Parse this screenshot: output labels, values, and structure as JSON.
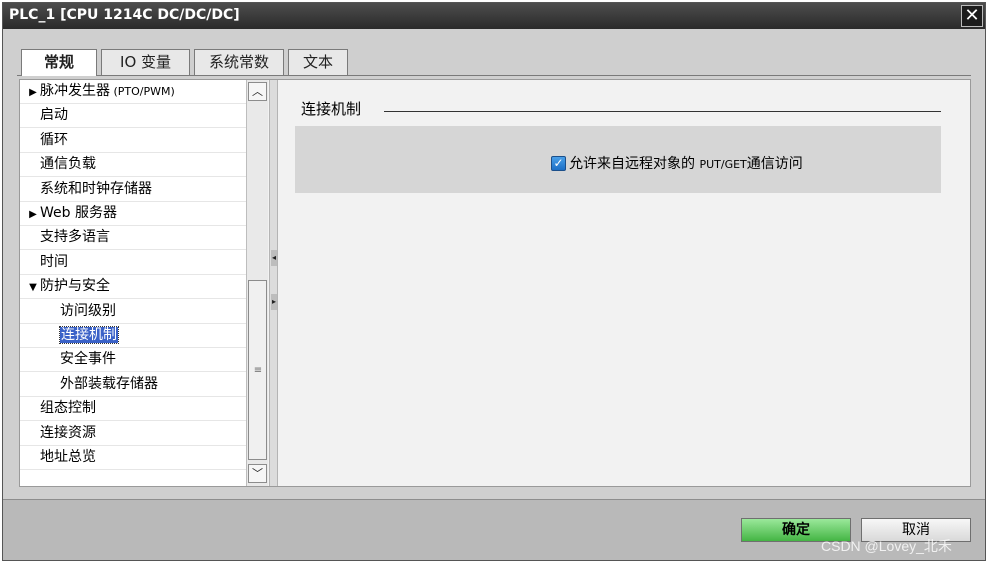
{
  "window": {
    "title": "PLC_1 [CPU 1214C DC/DC/DC]",
    "close_glyph": "✕"
  },
  "tabs": [
    {
      "label": "常规",
      "active": true
    },
    {
      "label": "IO 变量",
      "active": false
    },
    {
      "label": "系统常数",
      "active": false
    },
    {
      "label": "文本",
      "active": false
    }
  ],
  "nav": {
    "items": [
      {
        "label": "脉冲发生器",
        "suffix": " (PTO/PWM)",
        "expander": "▶",
        "indent": 0
      },
      {
        "label": "启动",
        "indent": 0
      },
      {
        "label": "循环",
        "indent": 0
      },
      {
        "label": "通信负载",
        "indent": 0
      },
      {
        "label": "系统和时钟存储器",
        "indent": 0
      },
      {
        "label": "Web 服务器",
        "expander": "▶",
        "indent": 0
      },
      {
        "label": "支持多语言",
        "indent": 0
      },
      {
        "label": "时间",
        "indent": 0
      },
      {
        "label": "防护与安全",
        "expander": "▼",
        "indent": 0
      },
      {
        "label": "访问级别",
        "indent": 1
      },
      {
        "label": "连接机制",
        "indent": 1,
        "selected": true
      },
      {
        "label": "安全事件",
        "indent": 1
      },
      {
        "label": "外部装载存储器",
        "indent": 1
      },
      {
        "label": "组态控制",
        "indent": 0
      },
      {
        "label": "连接资源",
        "indent": 0
      },
      {
        "label": "地址总览",
        "indent": 0
      }
    ],
    "scroll_up_glyph": "︿",
    "scroll_down_glyph": "﹀",
    "grip_glyph": "≡"
  },
  "section": {
    "title": "连接机制",
    "checkbox_checked": true,
    "checkbox_label_pre": "允许来自远程对象的 ",
    "checkbox_label_code": "PUT/GET",
    "checkbox_label_post": "通信访问"
  },
  "footer": {
    "ok_label": "确定",
    "cancel_label": "取消",
    "watermark": "CSDN @Lovey_北禾"
  },
  "colors": {
    "selection": "#3a62c8",
    "ok_button": "#44b544",
    "checkbox": "#1c6fc6"
  }
}
